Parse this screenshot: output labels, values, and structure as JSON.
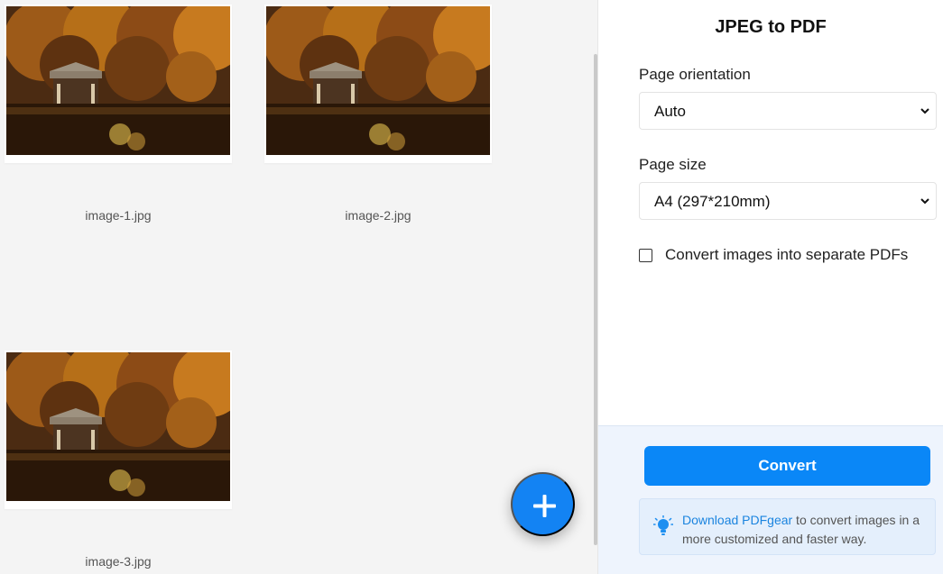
{
  "gallery": {
    "images": [
      {
        "filename": "image-1.jpg"
      },
      {
        "filename": "image-2.jpg"
      },
      {
        "filename": "image-3.jpg"
      }
    ],
    "add_button_icon": "plus-icon"
  },
  "panel": {
    "title": "JPEG to PDF",
    "orientation": {
      "label": "Page orientation",
      "value": "Auto"
    },
    "page_size": {
      "label": "Page size",
      "value": "A4 (297*210mm)"
    },
    "separate_pdfs": {
      "label": "Convert images into separate PDFs",
      "checked": false
    },
    "convert_label": "Convert",
    "tip": {
      "link_text": "Download PDFgear",
      "text": " to convert images in a more customized and faster way.",
      "icon": "lightbulb-icon"
    }
  },
  "colors": {
    "accent": "#0A87F7",
    "fab": "#1383F3",
    "footer_background": "#EEF4FD",
    "tip_link": "#1A84DF"
  }
}
